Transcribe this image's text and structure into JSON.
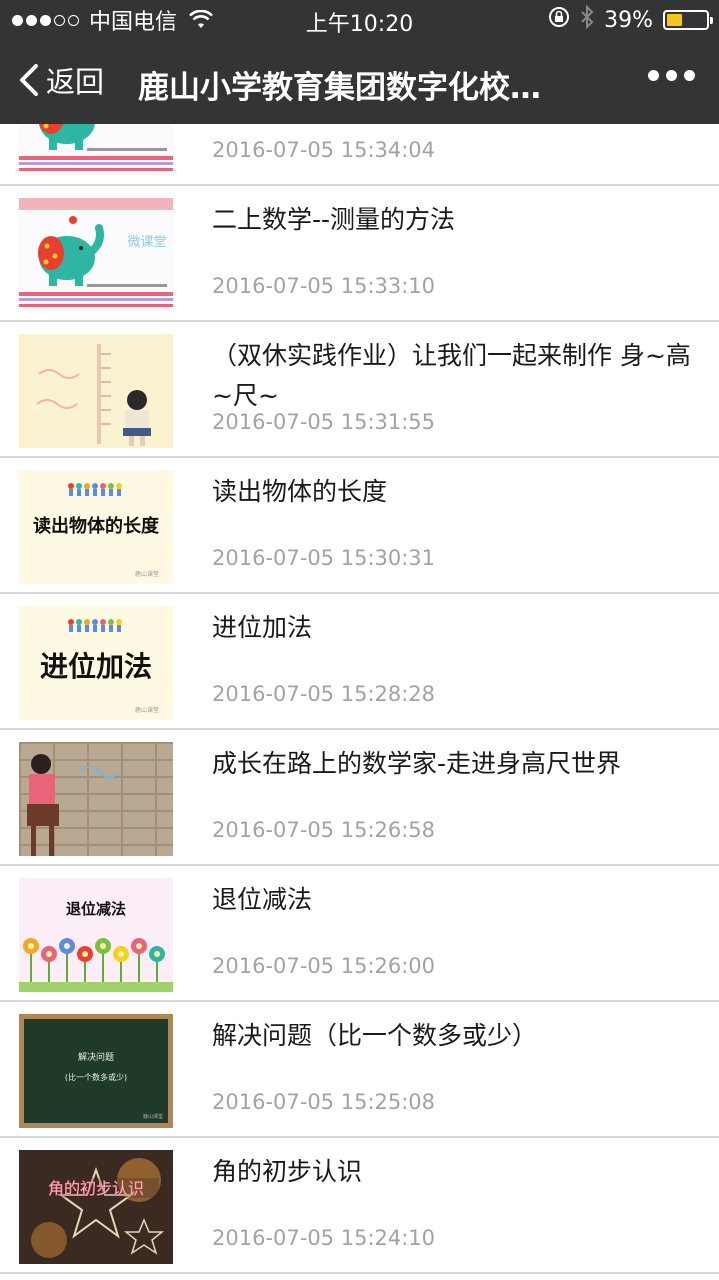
{
  "status_bar": {
    "carrier": "中国电信",
    "time": "上午10:20",
    "battery": "39%",
    "battery_level": 0.39,
    "battery_color": "#f5c518",
    "icons": [
      "signal-dots-icon",
      "wifi-icon",
      "rotation-lock-icon",
      "bluetooth-icon",
      "battery-icon"
    ]
  },
  "nav": {
    "back_label": "返回",
    "title": "鹿山小学教育集团数字化校…",
    "more_icon": "more-dots-icon",
    "bar_color": "#343437"
  },
  "items": [
    {
      "title": "",
      "date": "2016-07-05 15:34:04",
      "thumb": "elephant-micro-lesson"
    },
    {
      "title": "二上数学--测量的方法",
      "date": "2016-07-05 15:33:10",
      "thumb": "elephant-micro-lesson"
    },
    {
      "title": "（双休实践作业）让我们一起来制作 身~高~尺~",
      "date": "2016-07-05 15:31:55",
      "thumb": "girl-height-chart"
    },
    {
      "title": "读出物体的长度",
      "date": "2016-07-05 15:30:31",
      "thumb": "text-card",
      "thumb_text": "读出物体的长度"
    },
    {
      "title": "进位加法",
      "date": "2016-07-05 15:28:28",
      "thumb": "text-card",
      "thumb_text": "进位加法"
    },
    {
      "title": "成长在路上的数学家-走进身高尺世界",
      "date": "2016-07-05 15:26:58",
      "thumb": "child-wall-photo"
    },
    {
      "title": "退位减法",
      "date": "2016-07-05 15:26:00",
      "thumb": "flowers-card",
      "thumb_text": "退位减法"
    },
    {
      "title": "解决问题（比一个数多或少）",
      "date": "2016-07-05 15:25:08",
      "thumb": "blackboard",
      "thumb_text": "解决问题",
      "thumb_sub": "(比一个数多或少)"
    },
    {
      "title": "角的初步认识",
      "date": "2016-07-05 15:24:10",
      "thumb": "stars-photo",
      "thumb_text": "角的初步认识"
    }
  ]
}
